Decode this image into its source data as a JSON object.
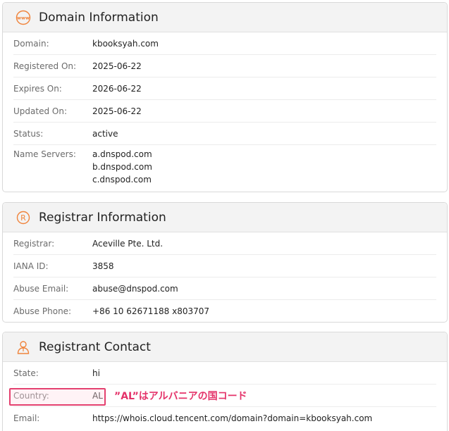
{
  "domain_info": {
    "title": "Domain Information",
    "icon": "www-globe-icon",
    "rows": [
      {
        "label": "Domain:",
        "value": "kbooksyah.com"
      },
      {
        "label": "Registered On:",
        "value": "2025-06-22"
      },
      {
        "label": "Expires On:",
        "value": "2026-06-22"
      },
      {
        "label": "Updated On:",
        "value": "2025-06-22"
      },
      {
        "label": "Status:",
        "value": "active"
      }
    ],
    "name_servers_label": "Name Servers:",
    "name_servers": [
      "a.dnspod.com",
      "b.dnspod.com",
      "c.dnspod.com"
    ]
  },
  "registrar_info": {
    "title": "Registrar Information",
    "icon": "registered-icon",
    "rows": [
      {
        "label": "Registrar:",
        "value": "Aceville Pte. Ltd."
      },
      {
        "label": "IANA ID:",
        "value": "3858"
      },
      {
        "label": "Abuse Email:",
        "value": "abuse@dnspod.com"
      },
      {
        "label": "Abuse Phone:",
        "value": "+86 10 62671188 x803707"
      }
    ]
  },
  "registrant_contact": {
    "title": "Registrant Contact",
    "icon": "person-icon",
    "rows": [
      {
        "label": "State:",
        "value": "hi"
      },
      {
        "label": "Country:",
        "value": "AL"
      },
      {
        "label": "Email:",
        "value": "https://whois.cloud.tencent.com/domain?domain=kbooksyah.com"
      }
    ]
  },
  "annotation": {
    "text": "”AL”はアルバニアの国コード"
  },
  "colors": {
    "icon_accent": "#f0843c",
    "annotation": "#e4336a"
  }
}
